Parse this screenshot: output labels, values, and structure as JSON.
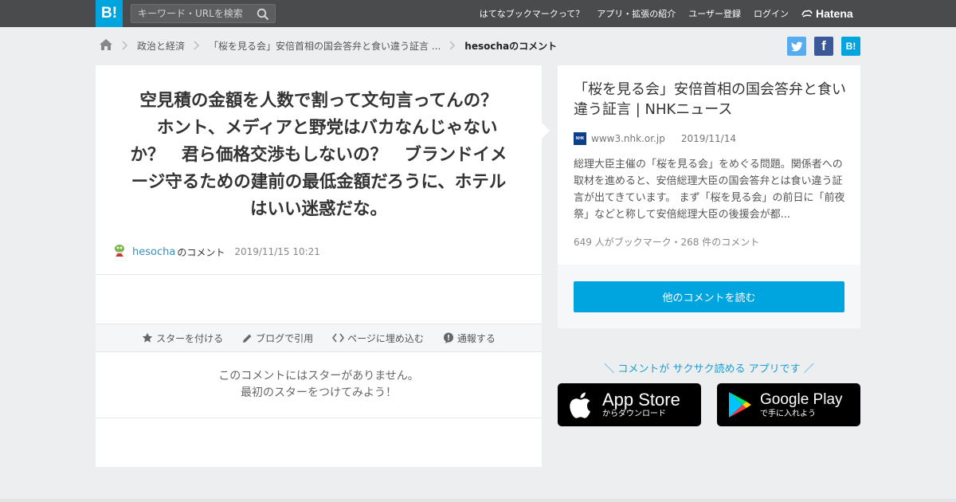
{
  "header": {
    "logo": "B!",
    "search_placeholder": "キーワード・URLを検索",
    "nav": [
      "はてなブックマークって？",
      "アプリ・拡張の紹介",
      "ユーザー登録",
      "ログイン"
    ],
    "hatena": "Hatena"
  },
  "breadcrumb": {
    "items": [
      "政治と経済",
      "「桜を見る会」安倍首相の国会答弁と食い違う証言 ...",
      "hesochaのコメント"
    ]
  },
  "share": {
    "facebook": "f",
    "hatebu": "B!"
  },
  "comment": {
    "text": "空見積の金額を人数で割って文句言ってんの？\n　ホント、メディアと野党はバカなんじゃない\nか？　君ら価格交渉もしないの？　ブランドイメ\nージ守るための建前の最低金額だろうに、ホテル\nはいい迷惑だな。",
    "user": "hesocha",
    "user_suffix": "のコメント",
    "date": "2019/11/15 10:21"
  },
  "actions": [
    "スターを付ける",
    "ブログで引用",
    "ページに埋め込む",
    "通報する"
  ],
  "no_stars": [
    "このコメントにはスターがありません。",
    "最初のスターをつけてみよう！"
  ],
  "entry": {
    "title": "「桜を見る会」安倍首相の国会答弁と食い違う証言 | NHKニュース",
    "favicon": "NHK",
    "domain": "www3.nhk.or.jp",
    "date": "2019/11/14",
    "description": "総理大臣主催の「桜を見る会」をめぐる問題。関係者への取材を進めると、安倍総理大臣の国会答弁とは食い違う証言が出てきています。 まず「桜を見る会」の前日に「前夜祭」などと称して安倍総理大臣の後援会が都...",
    "counts": "649 人がブックマーク・268 件のコメント",
    "button": "他のコメントを読む"
  },
  "promo": "＼ コメントが サクサク読める アプリです ／",
  "stores": {
    "apple": {
      "title": "App Store",
      "sub": "からダウンロード"
    },
    "google": {
      "title": "Google Play",
      "sub": "で手に入れよう"
    }
  },
  "colors": {
    "brand": "#00a4de",
    "header_bg": "#4a4b4c",
    "page_bg": "#eceef0",
    "link": "#3a90b8"
  }
}
